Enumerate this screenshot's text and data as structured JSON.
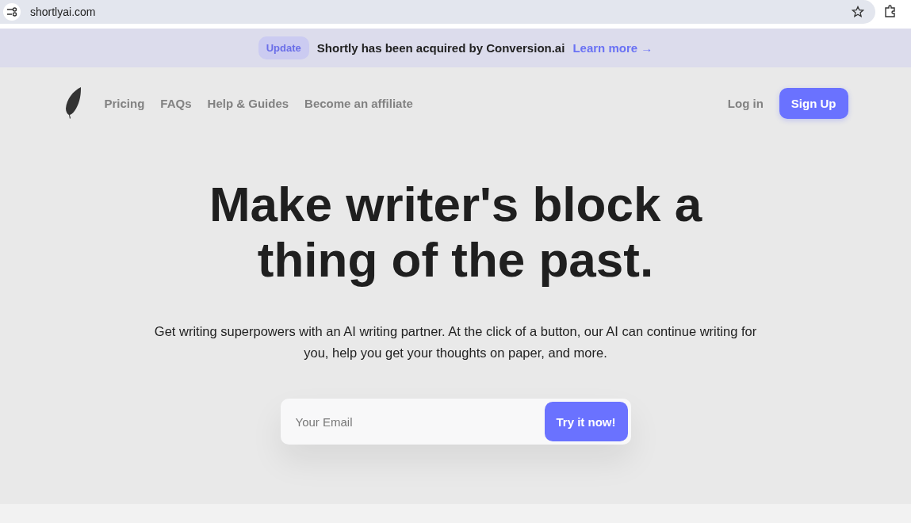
{
  "browser": {
    "url": "shortlyai.com"
  },
  "banner": {
    "badge": "Update",
    "message": "Shortly has been acquired by Conversion.ai",
    "link": "Learn more →"
  },
  "nav": {
    "links": [
      "Pricing",
      "FAQs",
      "Help & Guides",
      "Become an affiliate"
    ],
    "login": "Log in",
    "signup": "Sign Up"
  },
  "hero": {
    "title_lines": [
      "Make writer's block a",
      "thing of the past."
    ],
    "subtitle": "Get writing superpowers with an AI writing partner. At the click of a button, our AI can continue writing for you, help you get your thoughts on paper, and more."
  },
  "signup_form": {
    "placeholder": "Your Email",
    "button": "Try it now!"
  }
}
